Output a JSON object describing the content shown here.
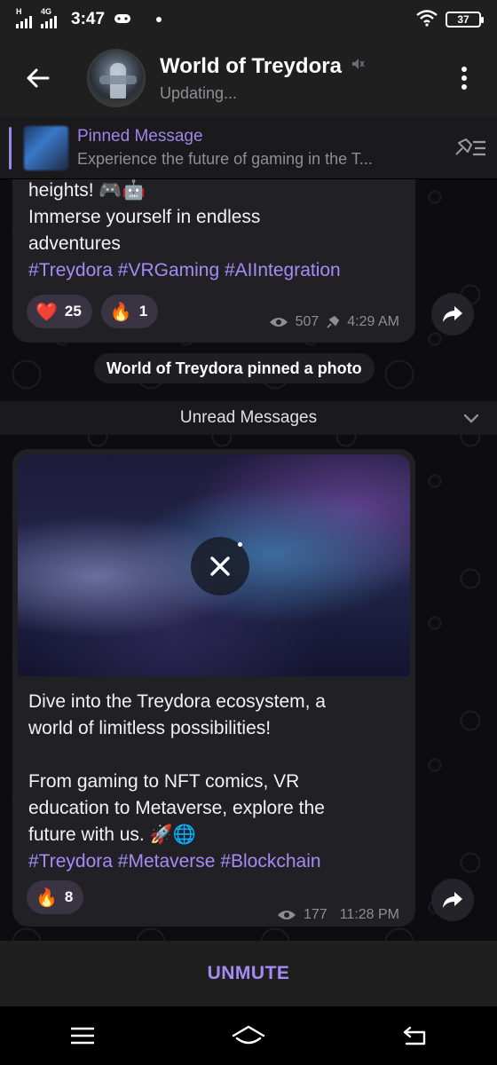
{
  "status_bar": {
    "network_label": "H",
    "network_label_2": "4G",
    "time": "3:47",
    "battery": "37"
  },
  "header": {
    "title": "World of Treydora",
    "subtitle": "Updating..."
  },
  "pinned": {
    "label": "Pinned Message",
    "preview": "Experience the future of gaming in the T..."
  },
  "messages": [
    {
      "lines": [
        "heights! 🎮🤖",
        "Immerse yourself in endless",
        "adventures"
      ],
      "tags": "#Treydora #VRGaming #AIIntegration",
      "reactions": [
        {
          "emoji": "❤️",
          "count": "25"
        },
        {
          "emoji": "🔥",
          "count": "1"
        }
      ],
      "views": "507",
      "time": "4:29 AM"
    },
    {
      "lines": [
        "Dive into the Treydora ecosystem, a",
        "world of limitless possibilities!",
        "",
        "From gaming to NFT comics, VR",
        "education to Metaverse, explore the",
        "future with us. 🚀🌐"
      ],
      "tags": "#Treydora #Metaverse #Blockchain",
      "reactions": [
        {
          "emoji": "🔥",
          "count": "8"
        }
      ],
      "views": "177",
      "time": "11:28 PM"
    }
  ],
  "service_message": "World of Treydora pinned a photo",
  "unread_label": "Unread Messages",
  "bottom": {
    "unmute_label": "UNMUTE"
  },
  "colors": {
    "accent": "#a58cf5",
    "bubble": "#212025",
    "bar": "#1f1f1f"
  },
  "icons": [
    "back-arrow-icon",
    "muted-icon",
    "more-vert-icon",
    "pin-list-icon",
    "views-icon",
    "pin-icon",
    "share-icon",
    "chevron-down-icon",
    "cancel-download-icon",
    "menu-icon",
    "home-icon",
    "back-nav-icon"
  ]
}
